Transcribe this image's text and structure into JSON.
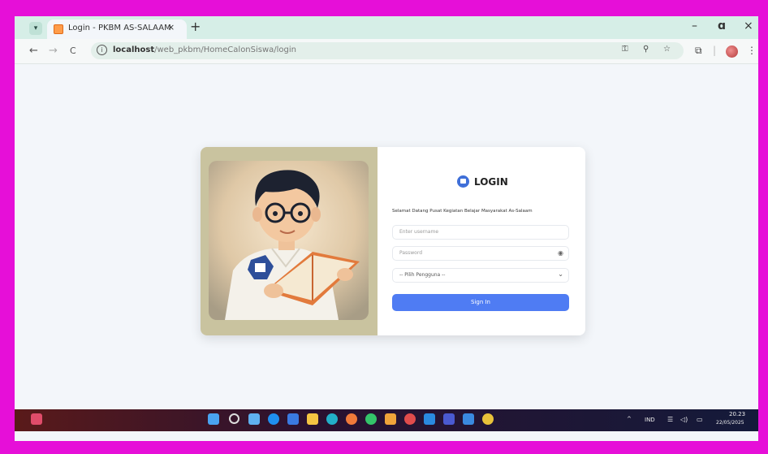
{
  "browser": {
    "tab_title": "Login - PKBM AS-SALAAM",
    "tab_close": "×",
    "new_tab": "+",
    "window_controls": {
      "minimize": "–",
      "maximize": "ɑ",
      "close": "×"
    },
    "nav": {
      "back": "←",
      "forward": "→",
      "reload": "C"
    },
    "url_host": "localhost",
    "url_path": "/web_pkbm/HomeCalonSiswa/login",
    "address_icons": [
      "password-key-icon",
      "zoom-icon",
      "star-icon"
    ],
    "toolbar_icons": [
      "extensions-icon",
      "profile-avatar",
      "kebab-menu-icon"
    ]
  },
  "login": {
    "logo_text": "LOGIN",
    "welcome": "Selamat Datang Pusat Kegiatan Belajar Masyarakat As-Salaam",
    "username_placeholder": "Enter username",
    "password_placeholder": "Password",
    "role_selected": "-- Pilih Pengguna --",
    "sign_in": "Sign In"
  },
  "taskbar": {
    "tray_language": "IND",
    "time": "20.23",
    "date": "22/05/2025",
    "caret": "^"
  },
  "colors": {
    "frame": "#e60fd8",
    "tabbar": "#d6eee7",
    "accent_button": "#4f7cf3",
    "card_left": "#c9c39f"
  }
}
